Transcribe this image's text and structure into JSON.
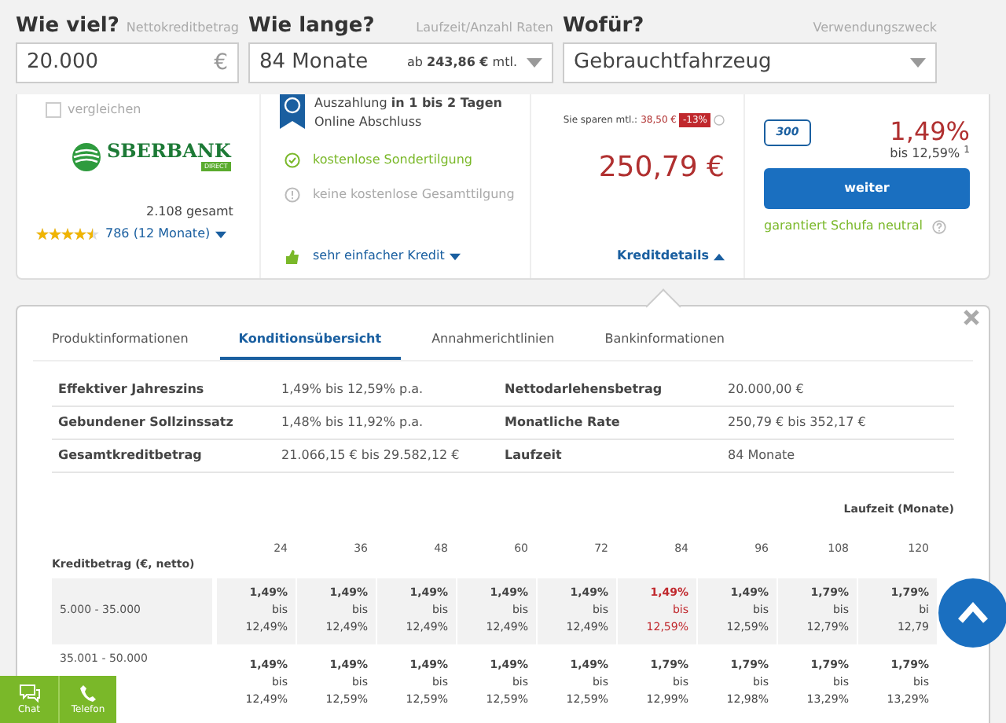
{
  "filters": [
    {
      "label": "Wie viel?",
      "hint": "Nettokreditbetrag",
      "kind": "amount",
      "value": "20.000",
      "suffix": "€"
    },
    {
      "label": "Wie lange?",
      "hint": "Laufzeit/Anzahl Raten",
      "kind": "select",
      "value": "84 Monate",
      "note_prefix": "ab",
      "note_amount": "243,86 €",
      "note_suffix": "mtl."
    },
    {
      "label": "Wofür?",
      "hint": "Verwendungszweck",
      "kind": "select",
      "value": "Gebrauchtfahrzeug"
    }
  ],
  "offer": {
    "compare": {
      "label": "vergleichen",
      "checked": false
    },
    "bank": {
      "name": "SBERBANK",
      "sub": "DIRECT"
    },
    "reviews": {
      "total": "2.108 gesamt",
      "stars": 4.5,
      "recent": "786 (12 Monate)"
    },
    "payout": "Auszahlung **in 1 bis 2 Tagen**",
    "online": "Online Abschluss",
    "features": [
      {
        "text": "kostenlose Sondertilgung",
        "included": true
      },
      {
        "text": "keine kostenlose Gesamttilgung",
        "included": false
      }
    ],
    "ease": "sehr einfacher Kredit",
    "savings_label": "Sie sparen mtl.:",
    "savings_amount": "38,50 €",
    "savings_pct": "-13%",
    "rate": "250,79 €",
    "details_link": "Kreditdetails",
    "details_expanded": true,
    "points": "300",
    "apr": "1,49%",
    "apr_max": "bis 12,59% $^{1}$",
    "button": "weiter",
    "schufa": "garantiert Schufa neutral"
  },
  "details": {
    "tabs": [
      {
        "label": "Produktinformationen",
        "selected": false
      },
      {
        "label": "Konditionsübersicht",
        "selected": true
      },
      {
        "label": "Annahmerichtlinien",
        "selected": false
      },
      {
        "label": "Bankinformationen",
        "selected": false
      }
    ],
    "summary": [
      [
        "Effektiver Jahreszins",
        "1,49% bis 12,59% p.a.",
        "Nettodarlehensbetrag",
        "20.000,00 €"
      ],
      [
        "Gebundener Sollzinssatz",
        "1,48% bis 11,92% p.a.",
        "Monatliche Rate",
        "250,79 € bis 352,17 €"
      ],
      [
        "Gesamtkreditbetrag",
        "21.066,15 € bis 29.582,12 €",
        "Laufzeit",
        "84 Monate"
      ]
    ],
    "matrix": {
      "caption": "Laufzeit (Monate)",
      "row_header": "Kreditbetrag (€, netto)",
      "columns": [
        "24",
        "36",
        "48",
        "60",
        "72",
        "84",
        "96",
        "108",
        "120"
      ],
      "rows": [
        {
          "label": "5.000 - 35.000",
          "cells": [
            {
              "min": "1,49%",
              "bis": "bis",
              "max": "12,49%",
              "selected": false
            },
            {
              "min": "1,49%",
              "bis": "bis",
              "max": "12,49%",
              "selected": false
            },
            {
              "min": "1,49%",
              "bis": "bis",
              "max": "12,49%",
              "selected": false
            },
            {
              "min": "1,49%",
              "bis": "bis",
              "max": "12,49%",
              "selected": false
            },
            {
              "min": "1,49%",
              "bis": "bis",
              "max": "12,49%",
              "selected": false
            },
            {
              "min": "1,49%",
              "bis": "bis",
              "max": "12,59%",
              "selected": true
            },
            {
              "min": "1,49%",
              "bis": "bis",
              "max": "12,59%",
              "selected": false
            },
            {
              "min": "1,79%",
              "bis": "bis",
              "max": "12,79%",
              "selected": false
            },
            {
              "min": "1,79%",
              "bis": "bi",
              "max": "12,79",
              "selected": false
            }
          ]
        },
        {
          "label": "35.001 - 50.000",
          "cells": [
            {
              "min": "1,49%",
              "bis": "bis",
              "max": "12,49%",
              "selected": false
            },
            {
              "min": "1,49%",
              "bis": "bis",
              "max": "12,59%",
              "selected": false
            },
            {
              "min": "1,49%",
              "bis": "bis",
              "max": "12,59%",
              "selected": false
            },
            {
              "min": "1,49%",
              "bis": "bis",
              "max": "12,59%",
              "selected": false
            },
            {
              "min": "1,49%",
              "bis": "bis",
              "max": "12,59%",
              "selected": false
            },
            {
              "min": "1,79%",
              "bis": "bis",
              "max": "12,99%",
              "selected": false
            },
            {
              "min": "1,79%",
              "bis": "bis",
              "max": "12,98%",
              "selected": false
            },
            {
              "min": "1,79%",
              "bis": "bis",
              "max": "13,29%",
              "selected": false
            },
            {
              "min": "1,79%",
              "bis": "bis",
              "max": "13,29%",
              "selected": false
            }
          ]
        }
      ]
    }
  },
  "contact": [
    {
      "label": "Chat",
      "kind": "chat"
    },
    {
      "label": "Telefon",
      "kind": "phone"
    }
  ]
}
